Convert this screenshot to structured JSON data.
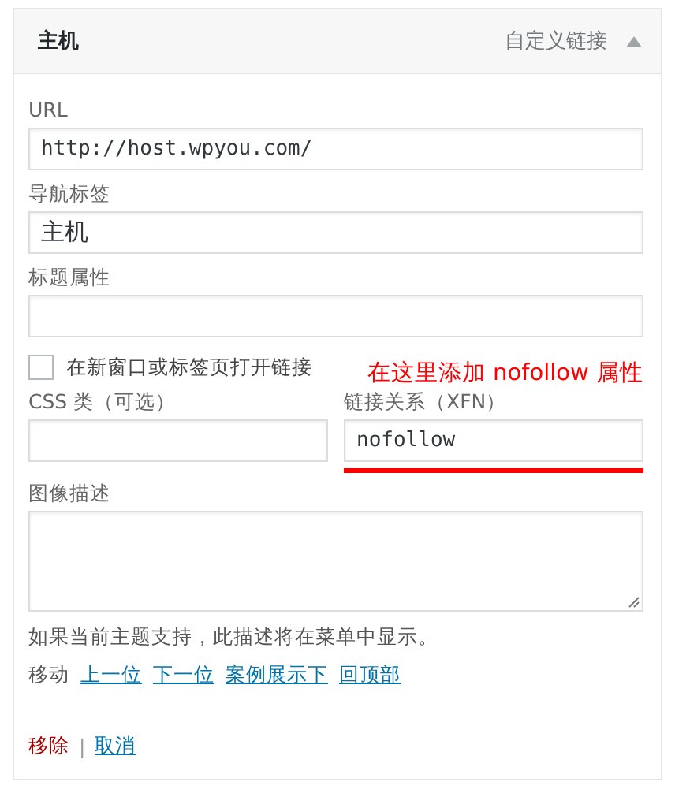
{
  "header": {
    "title": "主机",
    "type_label": "自定义链接",
    "expanded": true
  },
  "url": {
    "label": "URL",
    "value": "http://host.wpyou.com/"
  },
  "nav_label": {
    "label": "导航标签",
    "value": "主机"
  },
  "title_attr": {
    "label": "标题属性"
  },
  "new_tab": {
    "label": "在新窗口或标签页打开链接",
    "checked": false
  },
  "annotation": {
    "text": "在这里添加 nofollow 属性"
  },
  "css_classes": {
    "label": "CSS 类（可选）"
  },
  "xfn": {
    "label": "链接关系（XFN）",
    "value": "nofollow"
  },
  "description": {
    "label": "图像描述",
    "hint": "如果当前主题支持，此描述将在菜单中显示。"
  },
  "move": {
    "label": "移动",
    "links": [
      "上一位",
      "下一位",
      "案例展示下",
      "回顶部"
    ]
  },
  "actions": {
    "remove": "移除",
    "separator": "|",
    "cancel": "取消"
  }
}
